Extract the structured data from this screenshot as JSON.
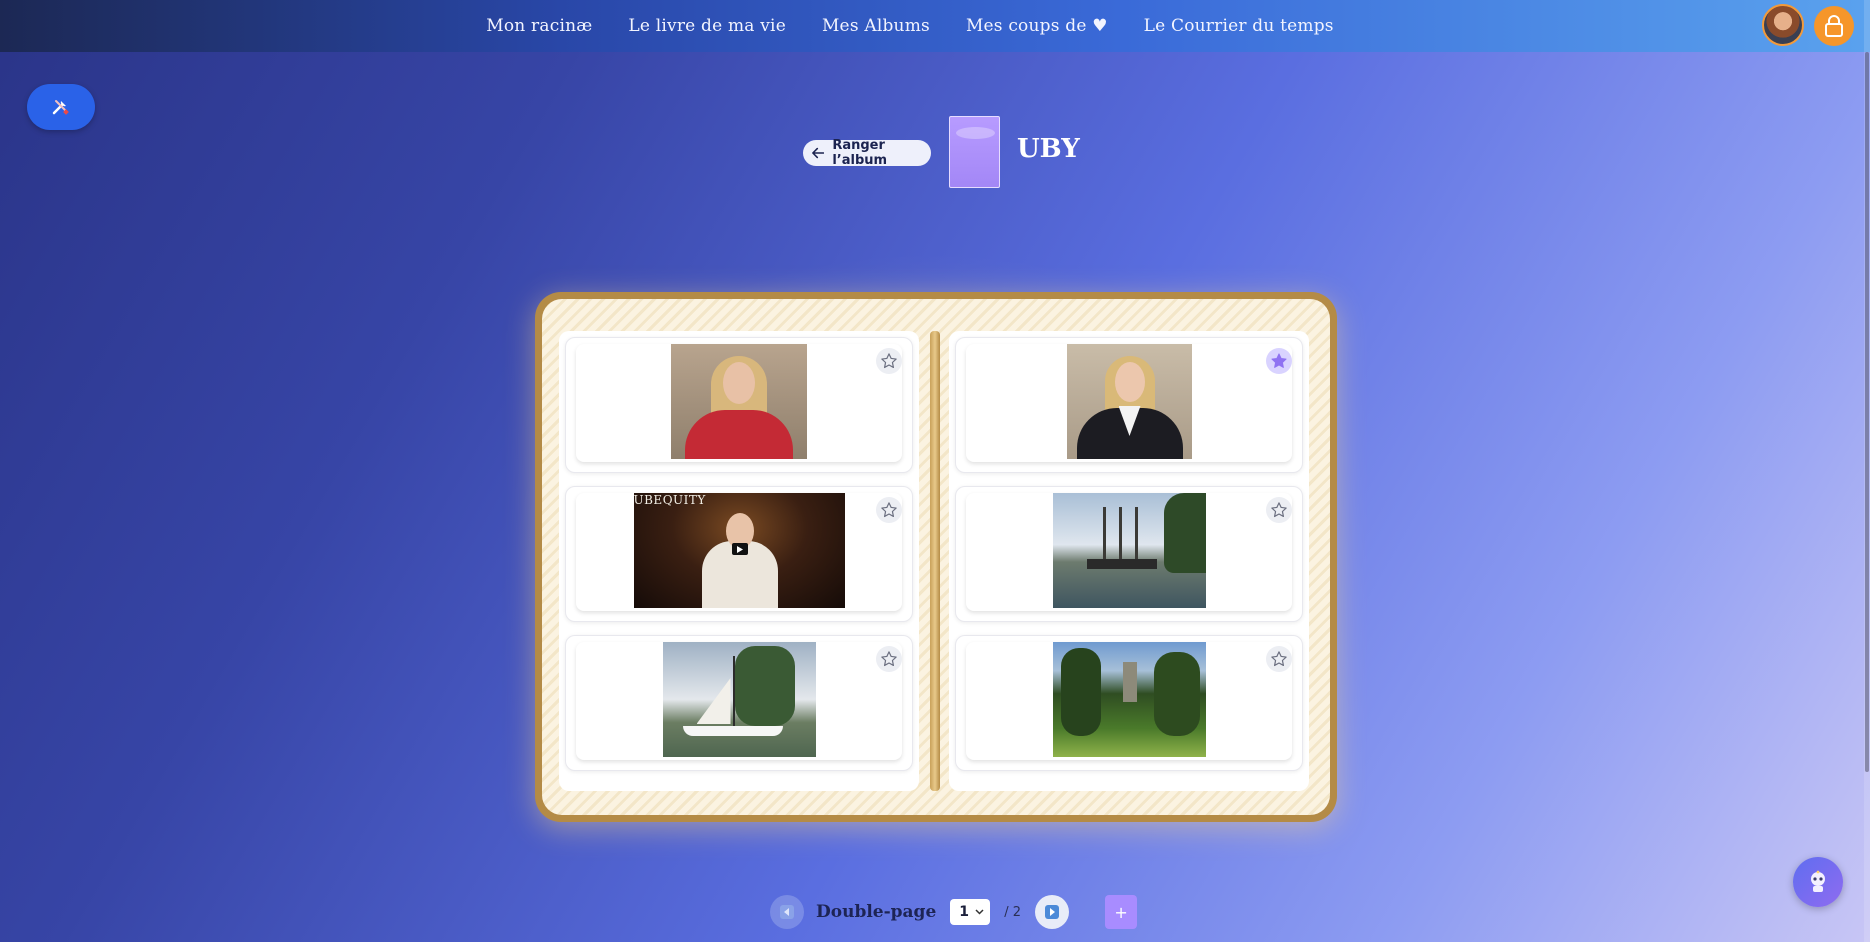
{
  "nav": {
    "items": [
      {
        "label": "Mon racinæ"
      },
      {
        "label": "Le livre de ma vie"
      },
      {
        "label": "Mes Albums"
      },
      {
        "label": "Mes coups de ♥"
      },
      {
        "label": "Le Courrier du temps"
      }
    ],
    "icons": {
      "lock": "lock-icon",
      "avatar": "user-avatar"
    }
  },
  "toolbar": {
    "tools_icon": "tools-icon"
  },
  "album": {
    "back_label": "Ranger l’album",
    "title": "UBY",
    "cover_color": "#a98cf9"
  },
  "book": {
    "left_page": [
      {
        "type": "photo",
        "favorite": false,
        "favorite_icon": "star-outline-icon"
      },
      {
        "type": "video",
        "caption": "UBEQUITY",
        "favorite": false,
        "favorite_icon": "star-outline-icon"
      },
      {
        "type": "photo",
        "favorite": false,
        "favorite_icon": "star-outline-icon"
      }
    ],
    "right_page": [
      {
        "type": "photo",
        "favorite": true,
        "favorite_icon": "star-filled-icon"
      },
      {
        "type": "photo",
        "favorite": false,
        "favorite_icon": "star-outline-icon"
      },
      {
        "type": "photo",
        "favorite": false,
        "favorite_icon": "star-outline-icon"
      }
    ]
  },
  "pager": {
    "label": "Double-page",
    "current": "1",
    "total": "/ 2",
    "add_label": "+"
  },
  "colors": {
    "accent": "#a88cff",
    "nav_start": "#1c2854",
    "nav_end": "#5aa2ee",
    "book_border": "#b48b46",
    "lock_button": "#f6962a"
  }
}
